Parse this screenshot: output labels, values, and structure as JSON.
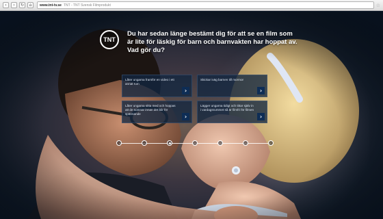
{
  "browser": {
    "back_icon": "back-icon",
    "forward_icon": "forward-icon",
    "reload_icon": "reload-icon",
    "home_icon": "home-icon",
    "url_host": "www.tnt-tv.se",
    "url_title": "TNT - TNT Svensk Filmprodukt"
  },
  "page": {
    "logo_text": "TNT",
    "question": "Du har sedan länge bestämt dig för att se en film som är lite för läskig för barn och barnvakten har hoppat av. Vad gör du?",
    "answers": [
      {
        "text": "Låter ungarna framför en video i ett annat rum"
      },
      {
        "text": "Skickar iväg barnen till mormor"
      },
      {
        "text": "Låter ungarna sitta med och hoppas att de somnar innan det blir för spännande"
      },
      {
        "text": "Lägger ungarna tidigt och tittar själv in i vardagsrummet så är filmfri för filmen"
      }
    ],
    "progress": {
      "total_steps": 7,
      "current_step": 3
    }
  },
  "colors": {
    "accent": "#0e2d55",
    "panel": "#12263f",
    "text": "#ffffff"
  }
}
